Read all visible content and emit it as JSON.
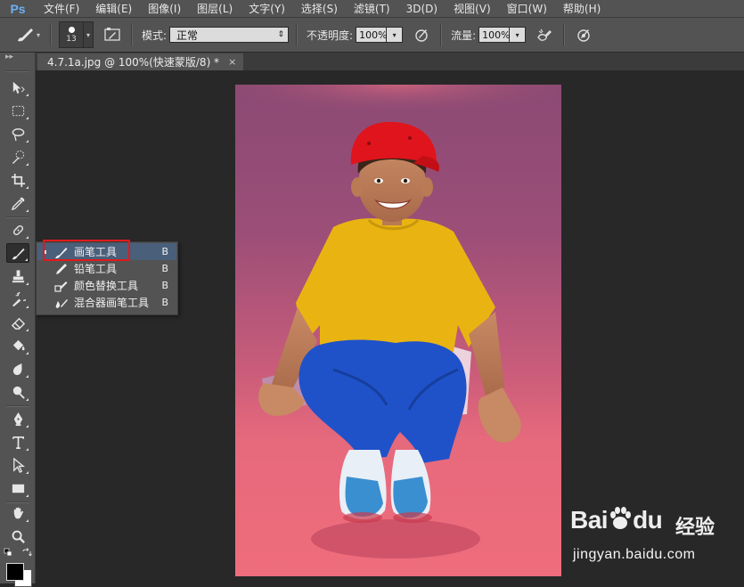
{
  "app": {
    "logo": "Ps"
  },
  "menubar": {
    "items": [
      "文件(F)",
      "编辑(E)",
      "图像(I)",
      "图层(L)",
      "文字(Y)",
      "选择(S)",
      "滤镜(T)",
      "3D(D)",
      "视图(V)",
      "窗口(W)",
      "帮助(H)"
    ]
  },
  "options": {
    "brush_size": "13",
    "mode_label": "模式:",
    "mode_value": "正常",
    "opacity_label": "不透明度:",
    "opacity_value": "100%",
    "flow_label": "流量:",
    "flow_value": "100%"
  },
  "document": {
    "tab_title": "4.7.1a.jpg @ 100%(快速蒙版/8) *",
    "close_glyph": "×"
  },
  "flyout": {
    "items": [
      {
        "label": "画笔工具",
        "shortcut": "B",
        "selected": true,
        "icon": "brush-icon"
      },
      {
        "label": "铅笔工具",
        "shortcut": "B",
        "selected": false,
        "icon": "pencil-icon"
      },
      {
        "label": "颜色替换工具",
        "shortcut": "B",
        "selected": false,
        "icon": "color-replacement-icon"
      },
      {
        "label": "混合器画笔工具",
        "shortcut": "B",
        "selected": false,
        "icon": "mixer-brush-icon"
      }
    ]
  },
  "colors": {
    "foreground": "#000000",
    "background": "#ffffff",
    "quickmask_tint": "#e8697c",
    "highlight": "#e21919",
    "ui_panel": "#535353"
  },
  "watermark": {
    "brand": "Bai",
    "brand_suffix": "du",
    "cn": "经验",
    "url": "jingyan.baidu.com"
  }
}
